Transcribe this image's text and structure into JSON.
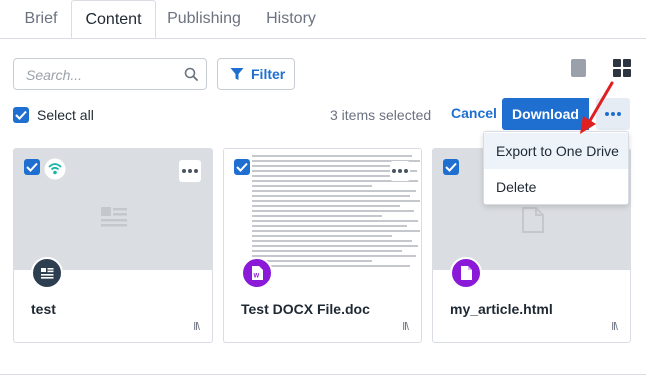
{
  "tabs": [
    {
      "label": "Brief",
      "active": false
    },
    {
      "label": "Content",
      "active": true
    },
    {
      "label": "Publishing",
      "active": false
    },
    {
      "label": "History",
      "active": false
    }
  ],
  "search": {
    "placeholder": "Search...",
    "value": "",
    "icon": "search-icon"
  },
  "filter": {
    "label": "Filter",
    "icon": "filter-icon"
  },
  "view_toggle": {
    "list_icon": "list-view-icon",
    "grid_icon": "grid-view-icon",
    "selected": "grid"
  },
  "selection": {
    "select_all_label": "Select all",
    "select_all_checked": true,
    "count_text": "3 items selected"
  },
  "actions": {
    "cancel": "Cancel",
    "download": "Download",
    "more_icon": "ellipsis-icon"
  },
  "menu": {
    "items": [
      "Export to One Drive",
      "Delete"
    ],
    "highlighted": "Export to One Drive"
  },
  "cards": [
    {
      "title": "test",
      "checked": true,
      "type_icon": "article-icon",
      "status_icon": "wifi-icon",
      "library_icon": "library-icon"
    },
    {
      "title": "Test DOCX File.doc",
      "checked": true,
      "type_icon": "word-doc-icon",
      "library_icon": "library-icon"
    },
    {
      "title": "my_article.html",
      "checked": true,
      "type_icon": "html-doc-icon",
      "library_icon": "library-icon"
    }
  ],
  "colors": {
    "accent": "#1f6fd1",
    "article_badge": "#2d3e50",
    "doc_badge": "#8b1ad8",
    "wifi": "#17b7a8",
    "arrow": "#e02020"
  }
}
